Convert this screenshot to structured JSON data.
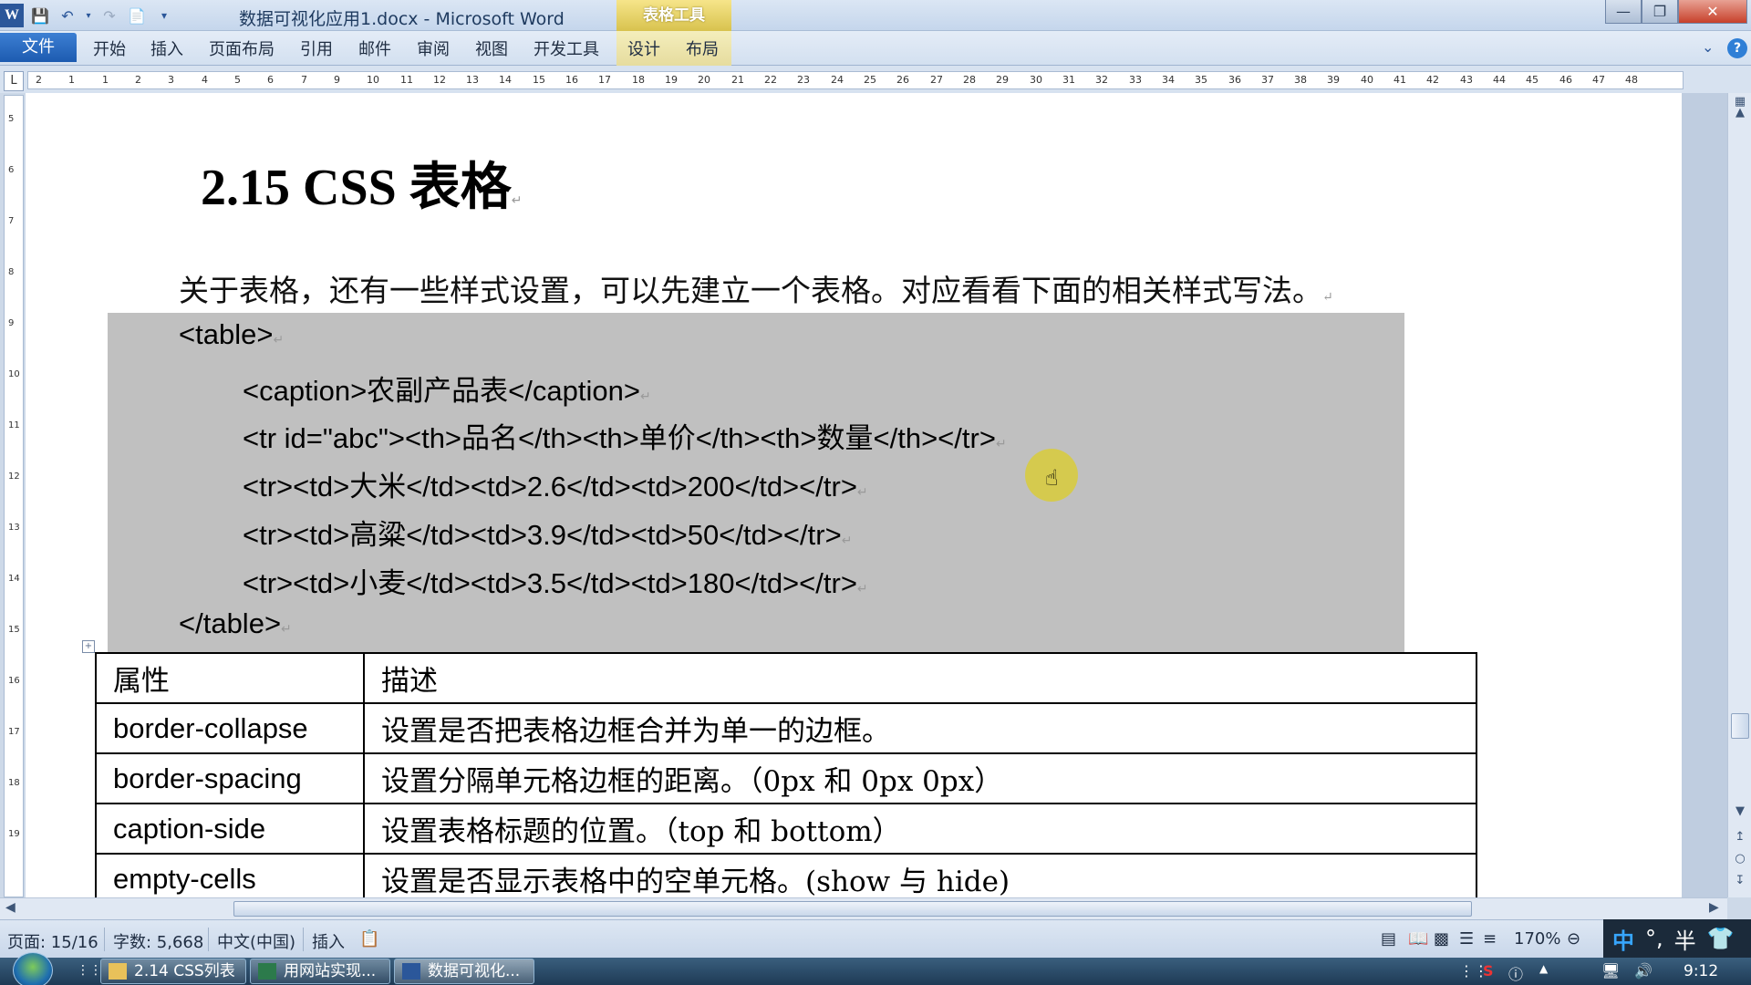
{
  "window": {
    "doc_title": "数据可视化应用1.docx - Microsoft Word",
    "context_tab_group": "表格工具",
    "min_icon": "minimize-icon",
    "max_icon": "restore-icon",
    "close_icon": "close-icon"
  },
  "ribbon": {
    "tabs": [
      "文件",
      "开始",
      "插入",
      "页面布局",
      "引用",
      "邮件",
      "审阅",
      "视图",
      "开发工具",
      "设计",
      "布局"
    ]
  },
  "ruler": {
    "numbers": [
      "2",
      "1",
      "1",
      "2",
      "3",
      "4",
      "5",
      "6",
      "7",
      "9",
      "10",
      "11",
      "12",
      "13",
      "14",
      "15",
      "16",
      "17",
      "18",
      "19",
      "20",
      "21",
      "22",
      "23",
      "24",
      "25",
      "26",
      "27",
      "28",
      "29",
      "30",
      "31",
      "32",
      "33",
      "34",
      "35",
      "36",
      "37",
      "38",
      "39",
      "40",
      "41",
      "42",
      "43",
      "44",
      "45",
      "46",
      "47",
      "48"
    ],
    "tab_selector": "L"
  },
  "document": {
    "heading": "2.15 CSS 表格",
    "intro": "关于表格，还有一些样式设置，可以先建立一个表格。对应看看下面的相关样式写法。",
    "code_lines": [
      "<table>",
      "<caption>农副产品表</caption>",
      "<tr id=\"abc\"><th>品名</th><th>单价</th><th>数量</th></tr>",
      "<tr><td>大米</td><td>2.6</td><td>200</td></tr>",
      "<tr><td>高粱</td><td>3.9</td><td>50</td></tr>",
      "<tr><td>小麦</td><td>3.5</td><td>180</td></tr>",
      "</table>"
    ],
    "table_rows": [
      {
        "prop": "属性",
        "desc": "描述"
      },
      {
        "prop": "border-collapse",
        "desc": "设置是否把表格边框合并为单一的边框。"
      },
      {
        "prop": "border-spacing",
        "desc": "设置分隔单元格边框的距离。（0px 和 0px 0px）"
      },
      {
        "prop": "caption-side",
        "desc": "设置表格标题的位置。（top 和 bottom）"
      },
      {
        "prop": "empty-cells",
        "desc": "设置是否显示表格中的空单元格。(show 与 hide)"
      }
    ]
  },
  "statusbar": {
    "page": "页面: 15/16",
    "words": "字数: 5,668",
    "language": "中文(中国)",
    "mode": "插入",
    "zoom": "170%"
  },
  "ime": {
    "lang": "中",
    "punct": "°,",
    "width": "半"
  },
  "taskbar": {
    "items": [
      "2.14 CSS列表",
      "用网站实现...",
      "数据可视化..."
    ],
    "time": "9:12"
  },
  "colors": {
    "accent": "#2b579a",
    "code_bg": "#c0c0c0",
    "tabletools": "#d8c24e"
  }
}
